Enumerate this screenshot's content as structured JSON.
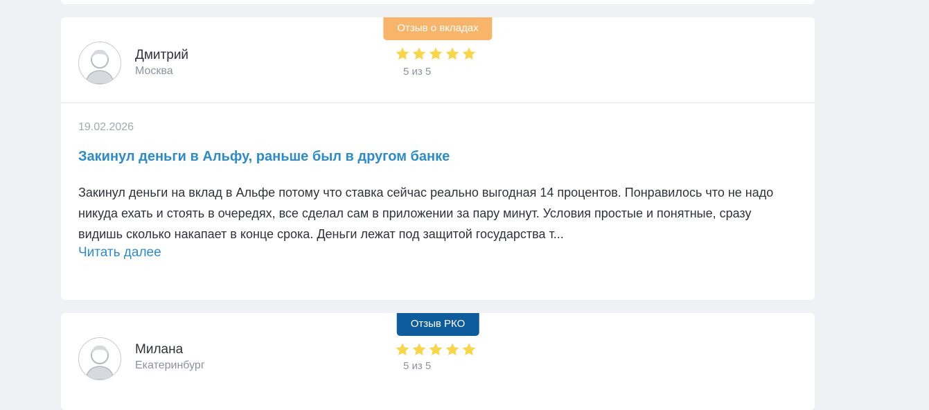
{
  "colors": {
    "background": "#eff1f4",
    "accent_blue": "#2d8bc9",
    "badge_deposit": "#f8b469",
    "badge_rko": "#0f5c9c",
    "star": "#f9d54a"
  },
  "reviews": [
    {
      "badge": "Отзыв о вкладах",
      "author": "Дмитрий",
      "city": "Москва",
      "rating_value": 5,
      "rating_text": "5 из 5",
      "date": "19.02.2026",
      "title": "Закинул деньги в Альфу, раньше был в другом банке",
      "body": "Закинул деньги на вклад в Альфе потому что ставка сейчас реально выгодная 14 процентов. Понравилось что не надо никуда ехать и стоять в очередях, все сделал сам в приложении за пару минут. Условия простые и понятные, сразу видишь сколько накапает в конце срока. Деньги лежат под защитой государства т...",
      "read_more": "Читать далее"
    },
    {
      "badge": "Отзыв РКО",
      "author": "Милана",
      "city": "Екатеринбург",
      "rating_value": 5,
      "rating_text": "5 из 5"
    }
  ]
}
